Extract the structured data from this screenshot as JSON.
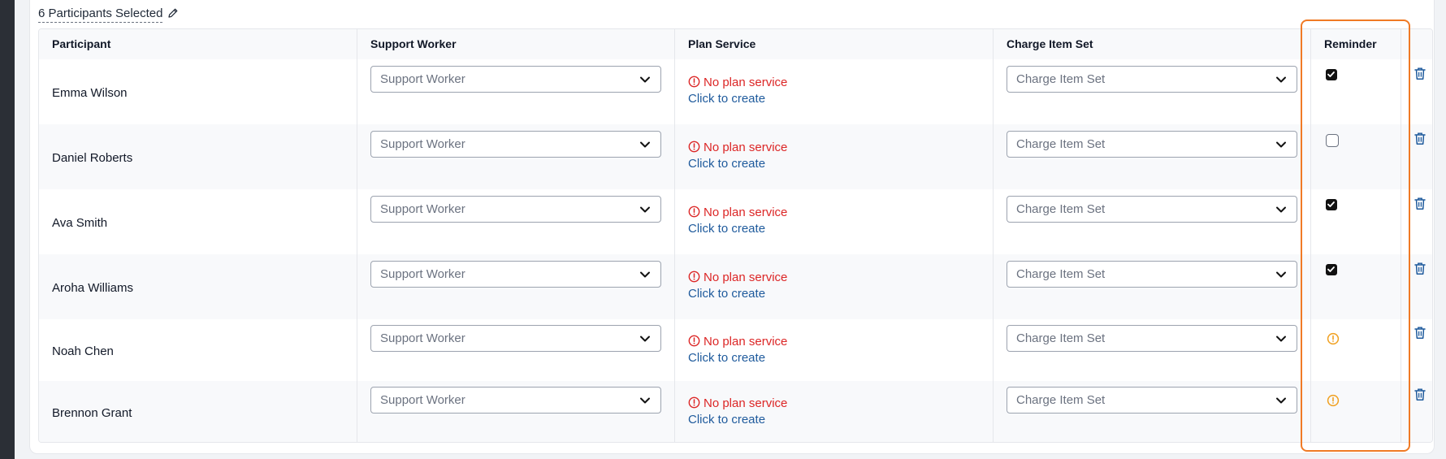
{
  "selection": {
    "label": "6 Participants Selected"
  },
  "columns": {
    "participant": "Participant",
    "support_worker": "Support Worker",
    "plan_service": "Plan Service",
    "charge_item_set": "Charge Item Set",
    "reminder": "Reminder"
  },
  "rows": [
    {
      "name": "Emma Wilson",
      "support_worker_placeholder": "Support Worker",
      "plan_error": "No plan service",
      "plan_link": "Click to create",
      "charge_placeholder": "Charge Item Set",
      "reminder": "checked"
    },
    {
      "name": "Daniel Roberts",
      "support_worker_placeholder": "Support Worker",
      "plan_error": "No plan service",
      "plan_link": "Click to create",
      "charge_placeholder": "Charge Item Set",
      "reminder": "unchecked"
    },
    {
      "name": "Ava Smith",
      "support_worker_placeholder": "Support Worker",
      "plan_error": "No plan service",
      "plan_link": "Click to create",
      "charge_placeholder": "Charge Item Set",
      "reminder": "checked"
    },
    {
      "name": "Aroha Williams",
      "support_worker_placeholder": "Support Worker",
      "plan_error": "No plan service",
      "plan_link": "Click to create",
      "charge_placeholder": "Charge Item Set",
      "reminder": "checked"
    },
    {
      "name": "Noah Chen",
      "support_worker_placeholder": "Support Worker",
      "plan_error": "No plan service",
      "plan_link": "Click to create",
      "charge_placeholder": "Charge Item Set",
      "reminder": "warning"
    },
    {
      "name": "Brennon Grant",
      "support_worker_placeholder": "Support Worker",
      "plan_error": "No plan service",
      "plan_link": "Click to create",
      "charge_placeholder": "Charge Item Set",
      "reminder": "warning"
    }
  ],
  "icons": {
    "edit": "pencil-icon",
    "dropdown": "chevron-down-icon",
    "error": "alert-circle-icon",
    "reminder_warning": "alert-circle-icon",
    "delete": "trash-icon",
    "checked": "checkmark-icon"
  },
  "colors": {
    "error": "#dc2626",
    "link": "#1e5a9c",
    "warning": "#f0a020",
    "delete": "#1e5a9c",
    "highlight": "#f07a25"
  }
}
